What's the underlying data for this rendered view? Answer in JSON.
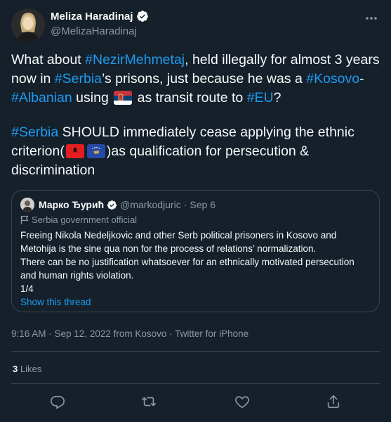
{
  "author": {
    "display_name": "Meliza Haradinaj",
    "handle": "@MelizaHaradinaj"
  },
  "tweet": {
    "line1_pre": "What about ",
    "tag_nezir": "#NezirMehmetaj",
    "line1_post": ", held illegally for almost 3 years now in ",
    "tag_serbia": "#Serbia",
    "line1_post2": "’s prisons, just because he was a ",
    "tag_kosovo": "#Kosovo",
    "dash": "-",
    "tag_albanian": "#Albanian",
    "using_text": " using ",
    "transit_text": " as transit route to ",
    "tag_eu": "#EU",
    "question": "?",
    "para2_tag": "#Serbia",
    "para2_text1": " SHOULD immediately cease applying the ethnic criterion(",
    "para2_text2": ")as qualification for persecution & discrimination"
  },
  "quote": {
    "display_name": "Марко Ђурић",
    "handle": "@markodjuric",
    "separator": "·",
    "date": "Sep 6",
    "label": "Serbia government official",
    "text_line1": "Freeing Nikola Nedeljkovic and other Serb political prisoners in Kosovo and Metohija is the sine qua non for the process of relations’ normalization.",
    "text_line2": "There can be no justification whatsoever for an ethnically motivated persecution and human rights violation.",
    "text_line3": "1/4",
    "show_thread": "Show this thread"
  },
  "meta": {
    "timestamp": "9:16 AM · Sep 12, 2022 from Kosovo · Twitter for iPhone"
  },
  "stats": {
    "likes_count": "3",
    "likes_label": "Likes"
  },
  "icons": {
    "verified": "verified-badge-icon",
    "more": "more-icon",
    "reply": "reply-icon",
    "retweet": "retweet-icon",
    "like": "heart-icon",
    "share": "share-icon"
  },
  "colors": {
    "background": "#15202b",
    "accent": "#1d9bf0",
    "muted": "#8b98a5",
    "border": "#38444d"
  }
}
